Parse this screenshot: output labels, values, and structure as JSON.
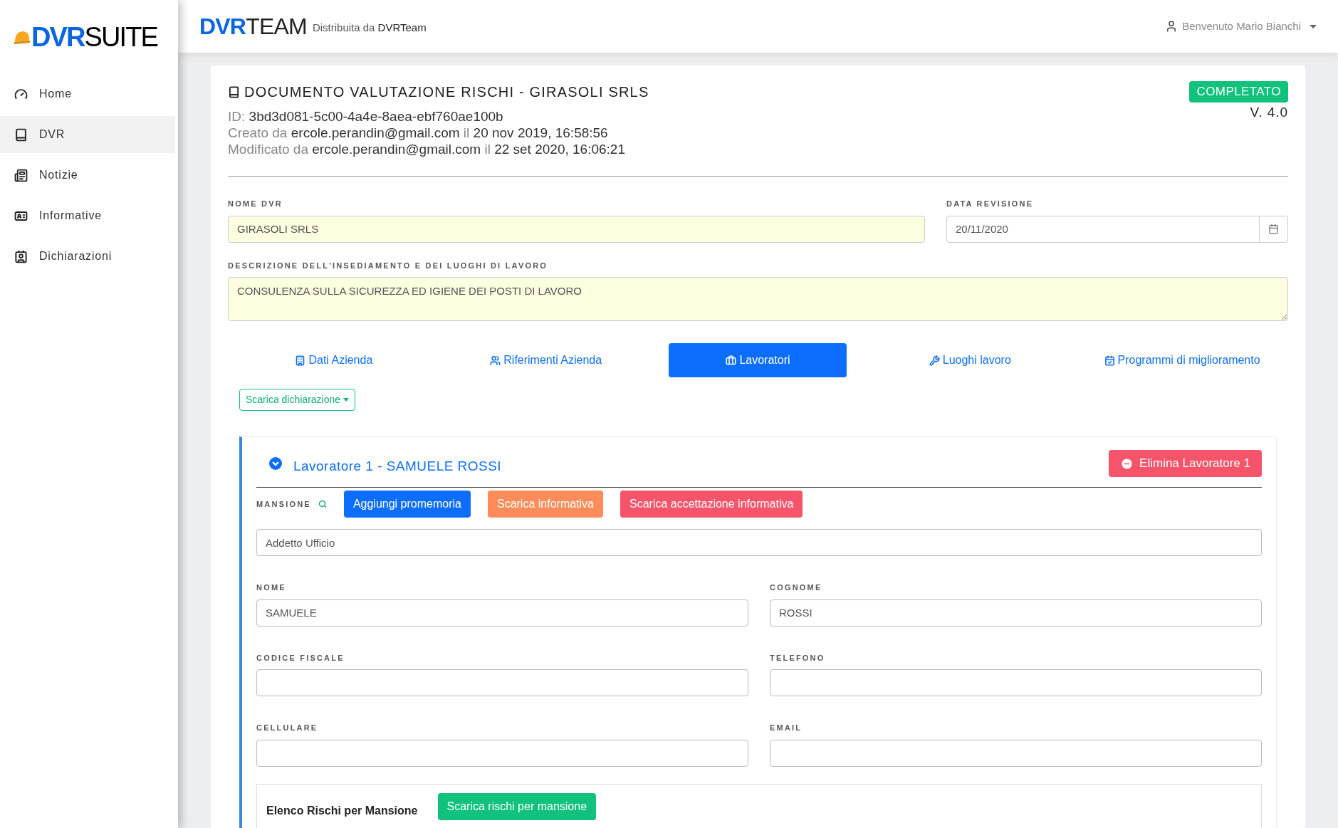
{
  "sidebar": {
    "logo": "**DVR**SUITE",
    "items": [
      {
        "label": "Home",
        "selected": false
      },
      {
        "label": "DVR",
        "selected": true
      },
      {
        "label": "Notizie",
        "selected": false
      },
      {
        "label": "Informative",
        "selected": false
      },
      {
        "label": "Dichiarazioni",
        "selected": false
      }
    ]
  },
  "header": {
    "brand": "**DVR**TEAM",
    "tagline": "Distribuita da **DVRTeam**",
    "user_menu": "Benvenuto Mario Bianchi"
  },
  "document": {
    "title": "DOCUMENTO VALUTAZIONE RISCHI - GIRASOLI SRLS",
    "meta": [
      "ID: **3bd3d081-5c00-4a4e-8aea-ebf760ae100b**",
      "Creato da **ercole.perandin@gmail.com** il **20 nov 2019, 16:58:56**",
      "Modificato da **ercole.perandin@gmail.com** il **22 set 2020, 16:06:21**"
    ],
    "status": "COMPLETATO",
    "version": "V. 4.0",
    "nome_dvr": {
      "label": "NOME DVR",
      "value": "GIRASOLI SRLS"
    },
    "data_revisione": {
      "label": "DATA REVISIONE",
      "value": "20/11/2020"
    },
    "descrizione": {
      "label": "DESCRIZIONE DELL'INSEDIAMENTO E DEI LUOGHI DI LAVORO",
      "value": "CONSULENZA SULLA SICUREZZA ED IGIENE DEI POSTI DI LAVORO"
    }
  },
  "tabs": [
    {
      "label": "Dati Azienda",
      "selected": false
    },
    {
      "label": "Riferimenti Azienda",
      "selected": false
    },
    {
      "label": "Lavoratori",
      "selected": true
    },
    {
      "label": "Luoghi lavoro",
      "selected": false
    },
    {
      "label": "Programmi di miglioramento",
      "selected": false
    }
  ],
  "download_menu": "Scarica dichiarazione",
  "worker": {
    "title": "Lavoratore 1 - SAMUELE ROSSI",
    "expanded": true,
    "delete_button": "Elimina Lavoratore 1",
    "mansione": {
      "label": "MANSIONE",
      "value": "Addetto Ufficio"
    },
    "actions": [
      {
        "label": "Aggiungi promemoria",
        "kind": "primary"
      },
      {
        "label": "Scarica informativa",
        "kind": "warning"
      },
      {
        "label": "Scarica accettazione informativa",
        "kind": "danger"
      }
    ],
    "fields": [
      {
        "label": "NOME",
        "value": "SAMUELE"
      },
      {
        "label": "COGNOME",
        "value": "ROSSI"
      },
      {
        "label": "CODICE FISCALE"
      },
      {
        "label": "TELEFONO"
      },
      {
        "label": "CELLULARE"
      },
      {
        "label": "EMAIL"
      }
    ],
    "risks": {
      "title": "Elenco Rischi per Mansione",
      "button": "Scarica rischi per mansione"
    }
  }
}
